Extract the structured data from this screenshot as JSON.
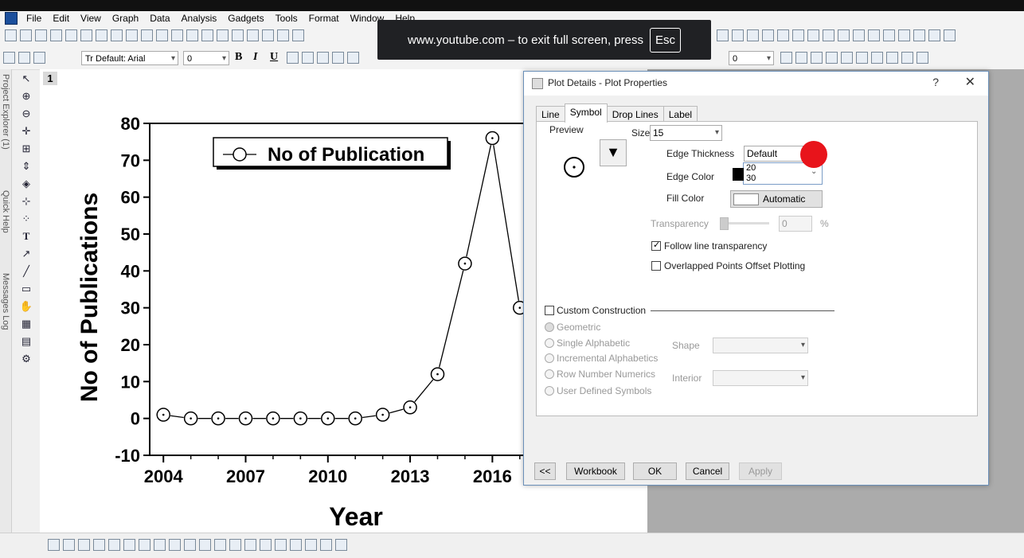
{
  "menu": {
    "items": [
      "File",
      "Edit",
      "View",
      "Graph",
      "Data",
      "Analysis",
      "Gadgets",
      "Tools",
      "Format",
      "Window",
      "Help"
    ]
  },
  "toolbar": {
    "font_name": "Tr Default: Arial",
    "font_size": "0",
    "bold": "B",
    "italic": "I",
    "underline": "U"
  },
  "left_panel": {
    "tabs": [
      "Project Explorer (1)",
      "Quick Help",
      "Messages Log"
    ]
  },
  "layer_badge": "1",
  "youtube_banner": {
    "text": "www.youtube.com – to exit full screen, press",
    "key": "Esc"
  },
  "chart_data": {
    "type": "line",
    "x": [
      2004,
      2005,
      2006,
      2007,
      2008,
      2009,
      2010,
      2011,
      2012,
      2013,
      2014,
      2015,
      2016,
      2017
    ],
    "series": [
      {
        "name": "No of Publication",
        "values": [
          1,
          0,
          0,
          0,
          0,
          0,
          0,
          0,
          1,
          3,
          12,
          42,
          76,
          30
        ]
      }
    ],
    "xlabel": "Year",
    "ylabel": "No of Publications",
    "xticks": [
      "2004",
      "2007",
      "2010",
      "2013",
      "2016"
    ],
    "yticks": [
      "-10",
      "0",
      "10",
      "20",
      "30",
      "40",
      "50",
      "60",
      "70",
      "80"
    ],
    "ylim": [
      -10,
      80
    ],
    "xlim": [
      2003.5,
      2017.5
    ],
    "legend_label": "No of Publication",
    "legend_position": "top-left"
  },
  "dialog": {
    "title": "Plot Details - Plot Properties",
    "help": "?",
    "close": "✕",
    "tabs": [
      "Line",
      "Symbol",
      "Drop Lines",
      "Label"
    ],
    "active_tab": "Symbol",
    "preview_label": "Preview",
    "size_label": "Size",
    "size_value": "15",
    "edge_thickness_label": "Edge Thickness",
    "edge_thickness_value": "Default",
    "edge_thickness_options": [
      "20",
      "30"
    ],
    "edge_color_label": "Edge Color",
    "fill_color_label": "Fill Color",
    "fill_color_value": "Automatic",
    "transparency_label": "Transparency",
    "transparency_value": "0",
    "transparency_unit": "%",
    "follow_line_transparency": "Follow line transparency",
    "overlapped_points": "Overlapped Points Offset Plotting",
    "custom_construction": "Custom Construction",
    "radios": [
      "Geometric",
      "Single Alphabetic",
      "Incremental Alphabetics",
      "Row Number Numerics",
      "User Defined Symbols"
    ],
    "shape_label": "Shape",
    "interior_label": "Interior",
    "buttons": {
      "back": "<<",
      "workbook": "Workbook",
      "ok": "OK",
      "cancel": "Cancel",
      "apply": "Apply"
    }
  },
  "colors": {
    "banner_bg": "#202124",
    "cursor_highlight": "#e8141b",
    "canvas_bg": "#ffffff",
    "workspace_bg": "#ababab"
  }
}
